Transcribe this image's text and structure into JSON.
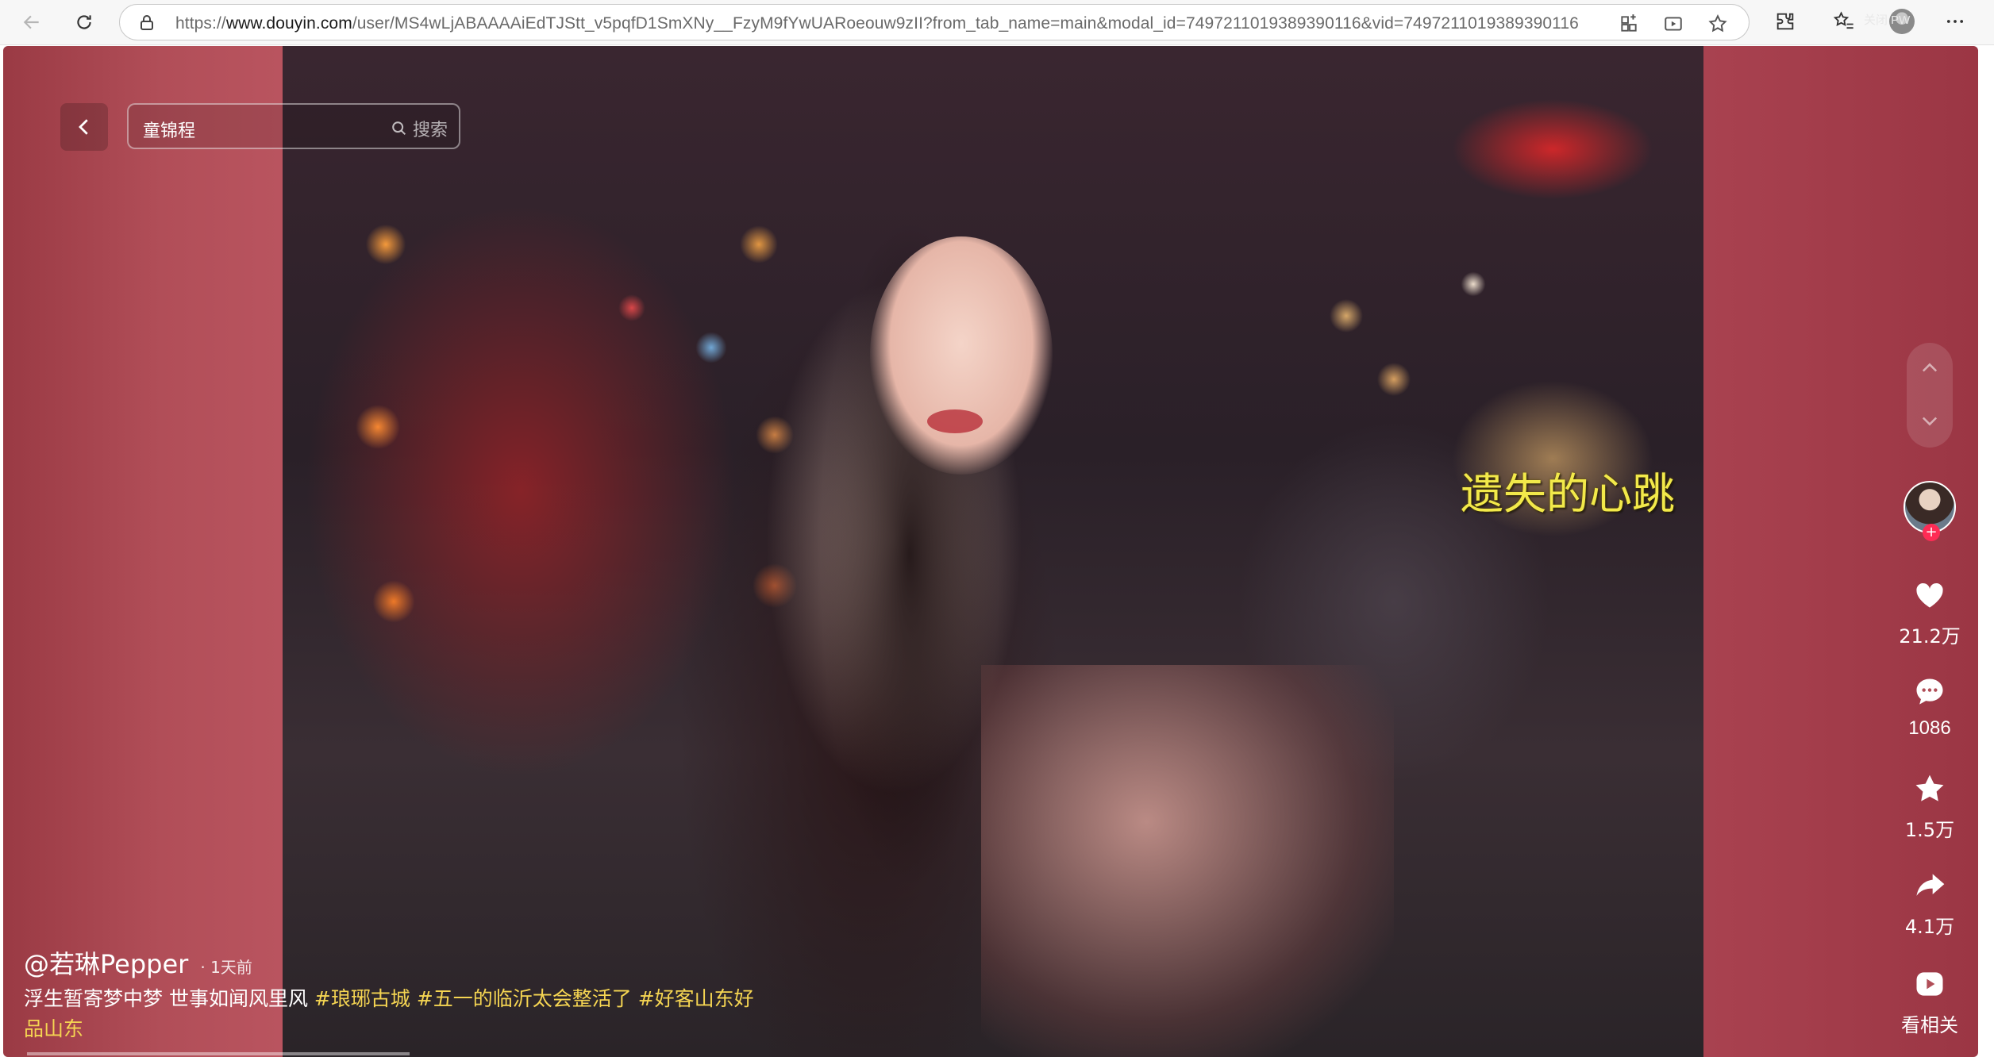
{
  "browser": {
    "url_prefix": "https://",
    "url_domain": "www.douyin.com",
    "url_path": "/user/MS4wLjABAAAAiEdTJStt_v5pqfD1SmXNy__FzyM9fYwUARoeouw9zII?from_tab_name=main&modal_id=7497211019389390116&vid=7497211019389390116",
    "profile_label": "关闭 PW"
  },
  "search": {
    "query": "童锦程",
    "button_label": "搜索"
  },
  "video": {
    "caption": "遗失的心跳"
  },
  "actions": {
    "likes": "21.2万",
    "comments": "1086",
    "favorites": "1.5万",
    "shares": "4.1万",
    "related_label": "看相关"
  },
  "post": {
    "author": "@若琳Pepper",
    "time": "· 1天前",
    "text": "浮生暂寄梦中梦 世事如闻风里风 ",
    "tags": [
      "#琅琊古城",
      "#五一的临沂太会整活了",
      "#好客山东好品山东"
    ]
  },
  "colors": {
    "accent_follow": "#fe2c55",
    "hashtag": "#f5d552",
    "caption": "#f2e94a"
  },
  "icons": [
    "back-arrow-icon",
    "reload-icon",
    "lock-icon",
    "apps-icon",
    "media-icon",
    "star-icon",
    "extensions-icon",
    "favorites-icon",
    "more-icon",
    "chevron-left-icon",
    "search-icon",
    "chevron-up-icon",
    "chevron-down-icon",
    "heart-icon",
    "comment-icon",
    "star-icon",
    "share-icon",
    "play-icon"
  ]
}
